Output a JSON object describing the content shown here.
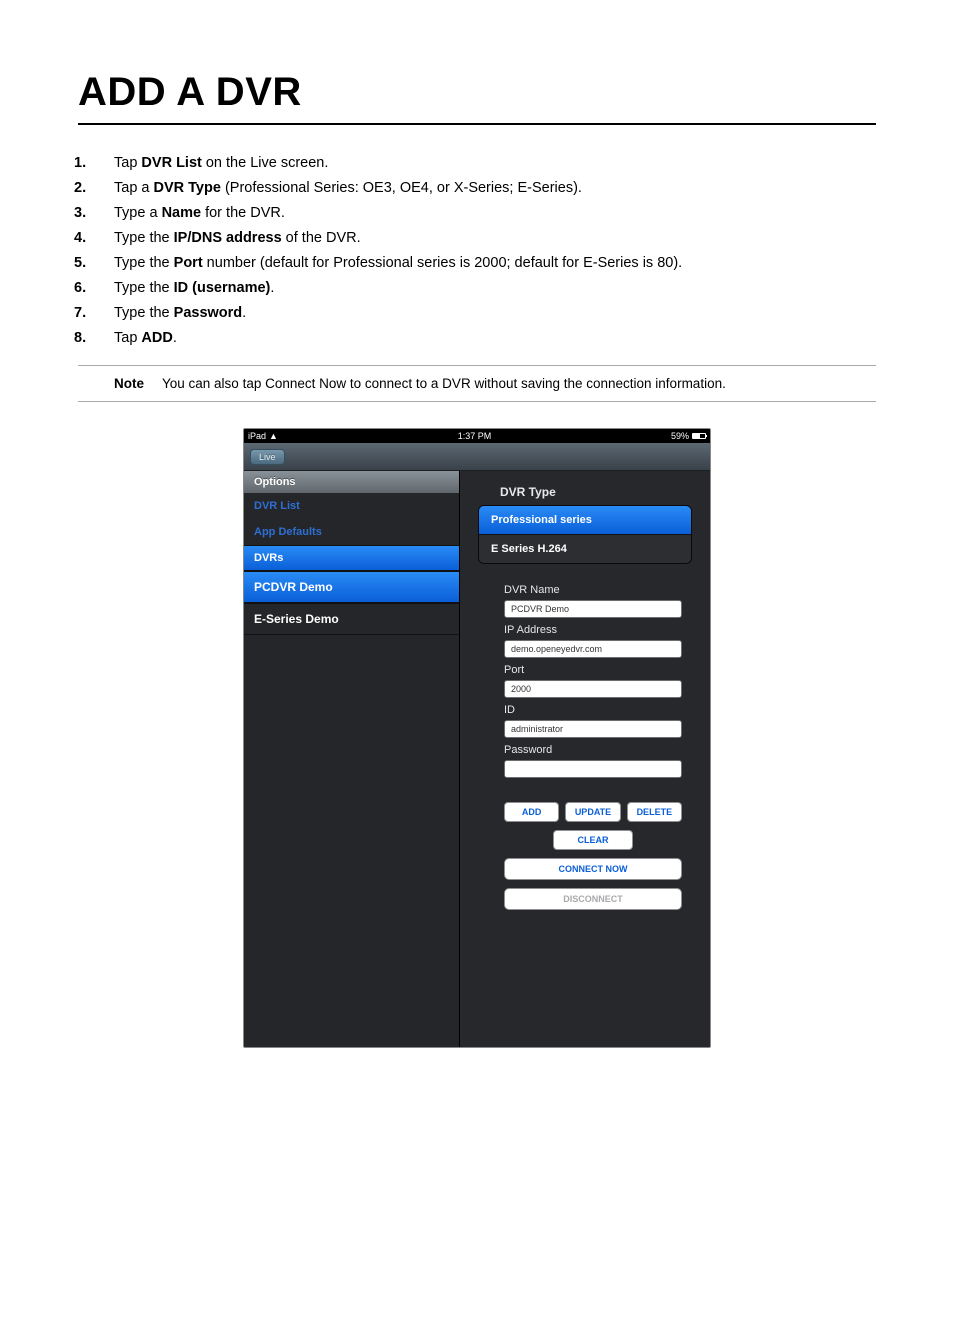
{
  "page": {
    "title": "ADD A DVR"
  },
  "steps": [
    {
      "n": "1.",
      "pre": "Tap ",
      "bold": "DVR List",
      "post": " on the Live screen."
    },
    {
      "n": "2.",
      "pre": "Tap a ",
      "bold": "DVR Type",
      "post": " (Professional Series: OE3, OE4, or X-Series; E-Series)."
    },
    {
      "n": "3.",
      "pre": "Type a ",
      "bold": "Name",
      "post": " for the DVR."
    },
    {
      "n": "4.",
      "pre": "Type the ",
      "bold": "IP/DNS address",
      "post": " of the DVR."
    },
    {
      "n": "5.",
      "pre": "Type the ",
      "bold": "Port",
      "post": " number (default for Professional series is 2000; default for E-Series is 80)."
    },
    {
      "n": "6.",
      "pre": "Type the ",
      "bold": "ID (username)",
      "post": "."
    },
    {
      "n": "7.",
      "pre": "Type the ",
      "bold": "Password",
      "post": "."
    },
    {
      "n": "8.",
      "pre": "Tap ",
      "bold": "ADD",
      "post": "."
    }
  ],
  "note": {
    "label": "Note",
    "text": "You can also tap Connect Now to connect to a DVR without saving the connection information."
  },
  "ipad": {
    "status": {
      "device": "iPad",
      "time": "1:37 PM",
      "battery_pct": "59%"
    },
    "nav": {
      "live_label": "Live"
    },
    "sidebar": {
      "options_header": "Options",
      "dvr_list_label": "DVR List",
      "app_defaults_label": "App Defaults",
      "dvrs_label": "DVRs",
      "items": [
        {
          "label": "PCDVR Demo",
          "selected": true
        },
        {
          "label": "E-Series Demo",
          "selected": false
        }
      ]
    },
    "content": {
      "dvr_type_title": "DVR Type",
      "types": [
        {
          "label": "Professional series",
          "selected": true
        },
        {
          "label": "E Series H.264",
          "selected": false
        }
      ],
      "fields": {
        "dvr_name": {
          "label": "DVR Name",
          "value": "PCDVR Demo"
        },
        "ip": {
          "label": "IP Address",
          "value": "demo.openeyedvr.com"
        },
        "port": {
          "label": "Port",
          "value": "2000"
        },
        "id": {
          "label": "ID",
          "value": "administrator"
        },
        "password": {
          "label": "Password",
          "value": ""
        }
      },
      "buttons": {
        "add": "ADD",
        "update": "UPDATE",
        "delete": "DELETE",
        "clear": "CLEAR",
        "connect": "CONNECT NOW",
        "disconnect": "DISCONNECT"
      }
    }
  }
}
